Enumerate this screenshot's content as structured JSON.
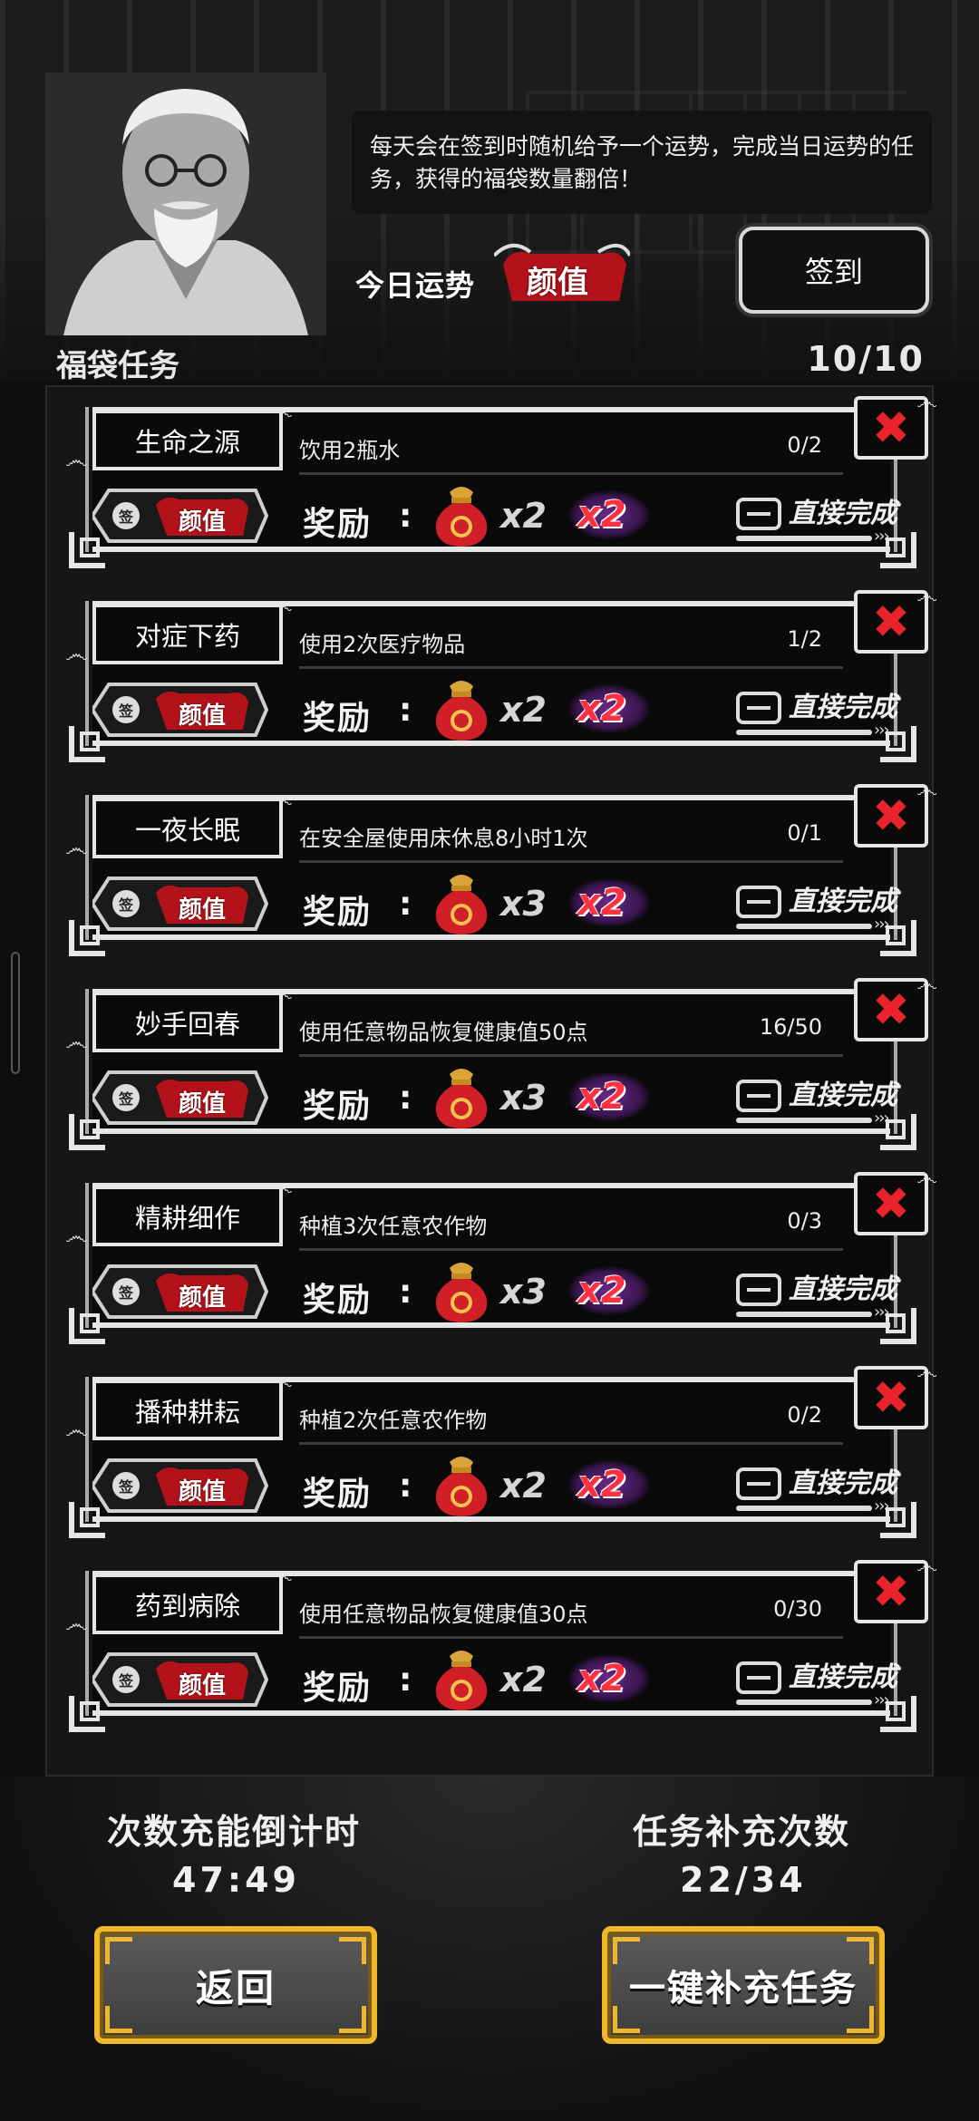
{
  "header": {
    "info_text": "每天会在签到时随机给予一个运势，完成当日运势的任务，获得的福袋数量翻倍！",
    "fortune_label": "今日运势",
    "fortune_value": "颜值",
    "signin_label": "签到"
  },
  "section": {
    "title": "福袋任务",
    "count": "10/10"
  },
  "task_common": {
    "sign_glyph": "签",
    "reward_label": "奖励",
    "reward_colon": ":",
    "multiplier": "x2",
    "complete_label": "直接完成",
    "arrows": "›››",
    "abandon_glyph": "✖"
  },
  "tasks": [
    {
      "name": "生命之源",
      "desc": "饮用2瓶水",
      "progress": "0/2",
      "fortune": "颜值",
      "reward_count": "x2"
    },
    {
      "name": "对症下药",
      "desc": "使用2次医疗物品",
      "progress": "1/2",
      "fortune": "颜值",
      "reward_count": "x2"
    },
    {
      "name": "一夜长眠",
      "desc": "在安全屋使用床休息8小时1次",
      "progress": "0/1",
      "fortune": "颜值",
      "reward_count": "x3"
    },
    {
      "name": "妙手回春",
      "desc": "使用任意物品恢复健康值50点",
      "progress": "16/50",
      "fortune": "颜值",
      "reward_count": "x3"
    },
    {
      "name": "精耕细作",
      "desc": "种植3次任意农作物",
      "progress": "0/3",
      "fortune": "颜值",
      "reward_count": "x3"
    },
    {
      "name": "播种耕耘",
      "desc": "种植2次任意农作物",
      "progress": "0/2",
      "fortune": "颜值",
      "reward_count": "x2"
    },
    {
      "name": "药到病除",
      "desc": "使用任意物品恢复健康值30点",
      "progress": "0/30",
      "fortune": "颜值",
      "reward_count": "x2"
    }
  ],
  "footer": {
    "recharge_title": "次数充能倒计时",
    "recharge_time": "47:49",
    "refill_title": "任务补充次数",
    "refill_count": "22/34",
    "back_label": "返回",
    "refill_button_label": "一键补充任务"
  },
  "colors": {
    "accent_red": "#e8232b",
    "button_gold": "#f0b72c",
    "badge_red": "#b3121b"
  },
  "icons": {
    "abandon": "close-x-icon",
    "bag": "lucky-bag-icon",
    "ticket": "ticket-icon",
    "portrait": "old-man-portrait"
  }
}
